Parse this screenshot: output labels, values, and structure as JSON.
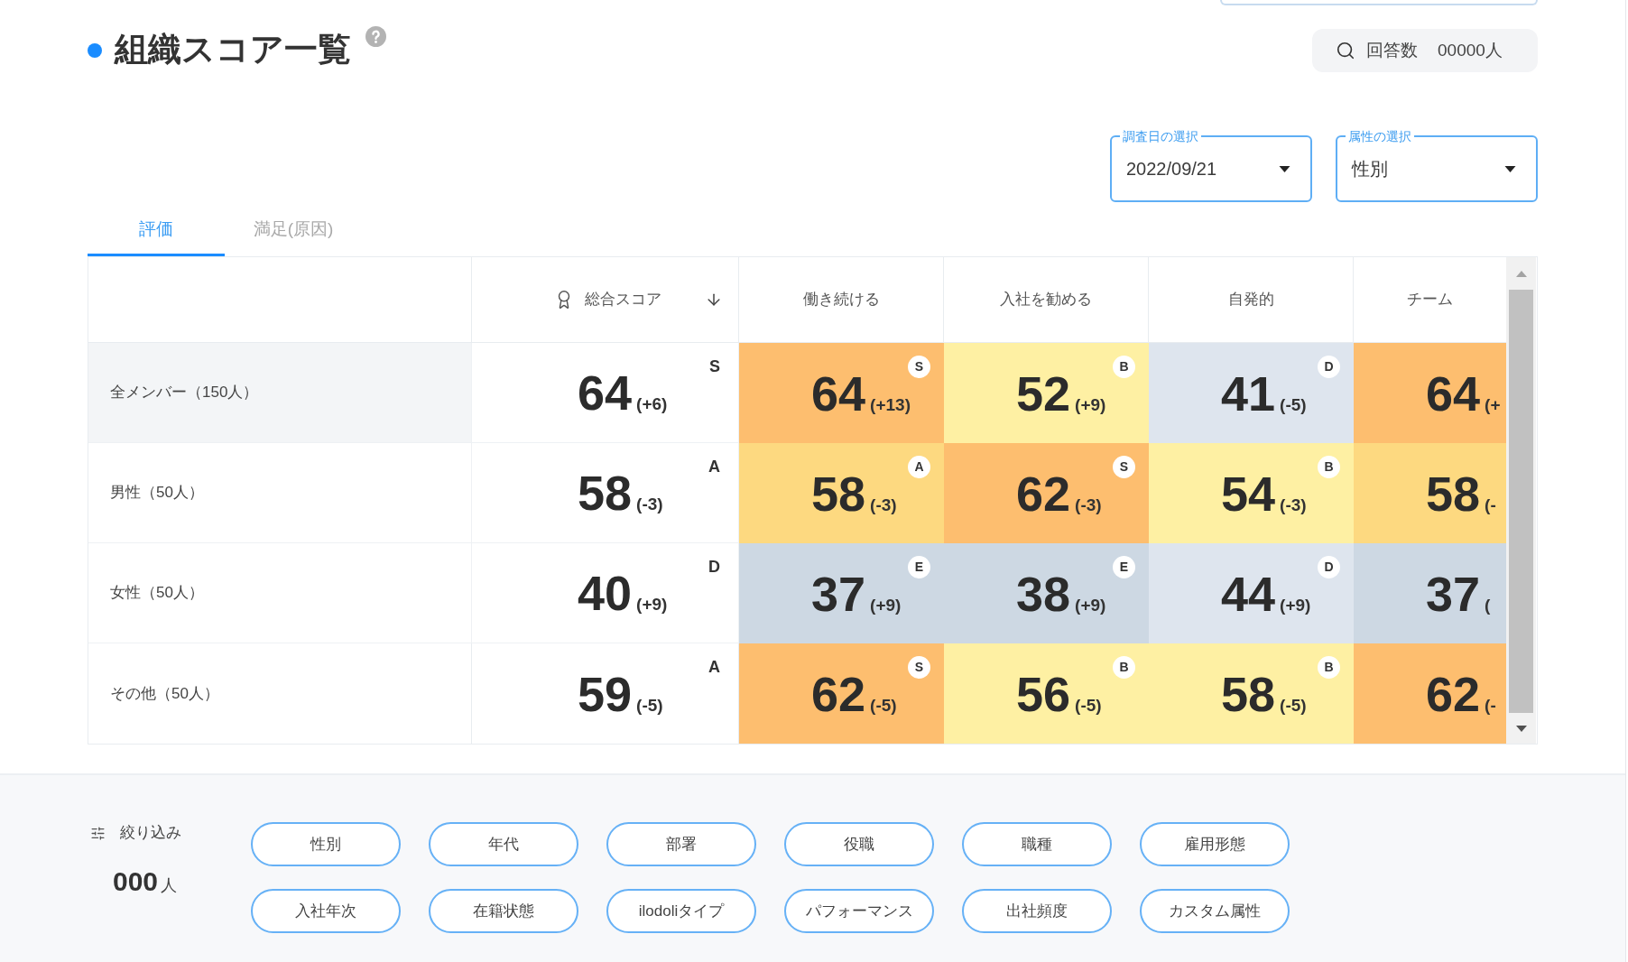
{
  "header": {
    "title": "組織スコア一覧",
    "response_count": {
      "label": "回答数",
      "value": "00000人"
    }
  },
  "selectors": [
    {
      "label": "調査日の選択",
      "value": "2022/09/21"
    },
    {
      "label": "属性の選択",
      "value": "性別"
    }
  ],
  "tabs": [
    {
      "label": "評価",
      "selected": true
    },
    {
      "label": "満足(原因)",
      "selected": false
    }
  ],
  "table": {
    "columns": [
      {
        "label": "総合スコア",
        "kind": "overall",
        "sorted": true
      },
      {
        "label": "働き続ける",
        "kind": "metric",
        "sorted": false
      },
      {
        "label": "入社を勧める",
        "kind": "metric",
        "sorted": false
      },
      {
        "label": "自発的",
        "kind": "metric",
        "sorted": false
      },
      {
        "label": "チーム",
        "kind": "metric",
        "sorted": false
      }
    ],
    "rows": [
      {
        "label": "全メンバー（150人）",
        "kind": "total",
        "cells": [
          {
            "score": "64",
            "change": "(+6)",
            "grade": "S"
          },
          {
            "score": "64",
            "change": "(+13)",
            "grade": "S",
            "color": "#fdbe6f"
          },
          {
            "score": "52",
            "change": "(+9)",
            "grade": "B",
            "color": "#fef0a3"
          },
          {
            "score": "41",
            "change": "(-5)",
            "grade": "D",
            "color": "#dee5ee"
          },
          {
            "score": "64",
            "change": "(+",
            "color": "#fdbe6f"
          }
        ]
      },
      {
        "label": "男性（50人）",
        "kind": "group",
        "cells": [
          {
            "score": "58",
            "change": "(-3)",
            "grade": "A"
          },
          {
            "score": "58",
            "change": "(-3)",
            "grade": "A",
            "color": "#fdd980"
          },
          {
            "score": "62",
            "change": "(-3)",
            "grade": "S",
            "color": "#fdbe6f"
          },
          {
            "score": "54",
            "change": "(-3)",
            "grade": "B",
            "color": "#fef0a3"
          },
          {
            "score": "58",
            "change": "(-",
            "color": "#fdd980"
          }
        ]
      },
      {
        "label": "女性（50人）",
        "kind": "group",
        "cells": [
          {
            "score": "40",
            "change": "(+9)",
            "grade": "D"
          },
          {
            "score": "37",
            "change": "(+9)",
            "grade": "E",
            "color": "#cdd8e3"
          },
          {
            "score": "38",
            "change": "(+9)",
            "grade": "E",
            "color": "#cdd8e3"
          },
          {
            "score": "44",
            "change": "(+9)",
            "grade": "D",
            "color": "#dee5ee"
          },
          {
            "score": "37",
            "change": "(",
            "color": "#cdd8e3"
          }
        ]
      },
      {
        "label": "その他（50人）",
        "kind": "group",
        "cells": [
          {
            "score": "59",
            "change": "(-5)",
            "grade": "A"
          },
          {
            "score": "62",
            "change": "(-5)",
            "grade": "S",
            "color": "#fdbe6f"
          },
          {
            "score": "56",
            "change": "(-5)",
            "grade": "B",
            "color": "#fef0a3"
          },
          {
            "score": "58",
            "change": "(-5)",
            "grade": "B",
            "color": "#fef0a3"
          },
          {
            "score": "62",
            "change": "(-",
            "color": "#fdbe6f"
          }
        ]
      }
    ]
  },
  "filter": {
    "label": "絞り込み",
    "count": "000",
    "unit": "人",
    "chips": [
      "性別",
      "年代",
      "部署",
      "役職",
      "職種",
      "雇用形態",
      "入社年次",
      "在籍状態",
      "ilodoliタイプ",
      "パフォーマンス",
      "出社頻度",
      "カスタム属性"
    ]
  }
}
